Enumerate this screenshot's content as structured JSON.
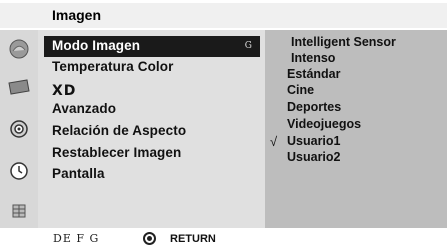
{
  "header": {
    "title": "Imagen"
  },
  "iconbar": {
    "icons": [
      "picture-icon",
      "screen-icon",
      "audio-icon",
      "clock-icon",
      "lock-icon"
    ]
  },
  "menu": {
    "items": [
      {
        "label": "Modo Imagen",
        "shortcut": "G",
        "selected": true
      },
      {
        "label": "Temperatura Color"
      },
      {
        "label": "XD"
      },
      {
        "label": "Avanzado"
      },
      {
        "label": "Relación de Aspecto"
      },
      {
        "label": "Restablecer Imagen"
      },
      {
        "label": "Pantalla"
      }
    ]
  },
  "options": {
    "items": [
      {
        "label": "Intelligent Sensor"
      },
      {
        "label": "Intenso"
      },
      {
        "label": "Estándar"
      },
      {
        "label": "Cine"
      },
      {
        "label": "Deportes"
      },
      {
        "label": "Videojuegos"
      },
      {
        "label": "Usuario1",
        "checked": true
      },
      {
        "label": "Usuario2"
      }
    ],
    "check_glyph": "√"
  },
  "footer": {
    "nav_keys": "DE F G",
    "return_label": "RETURN"
  }
}
